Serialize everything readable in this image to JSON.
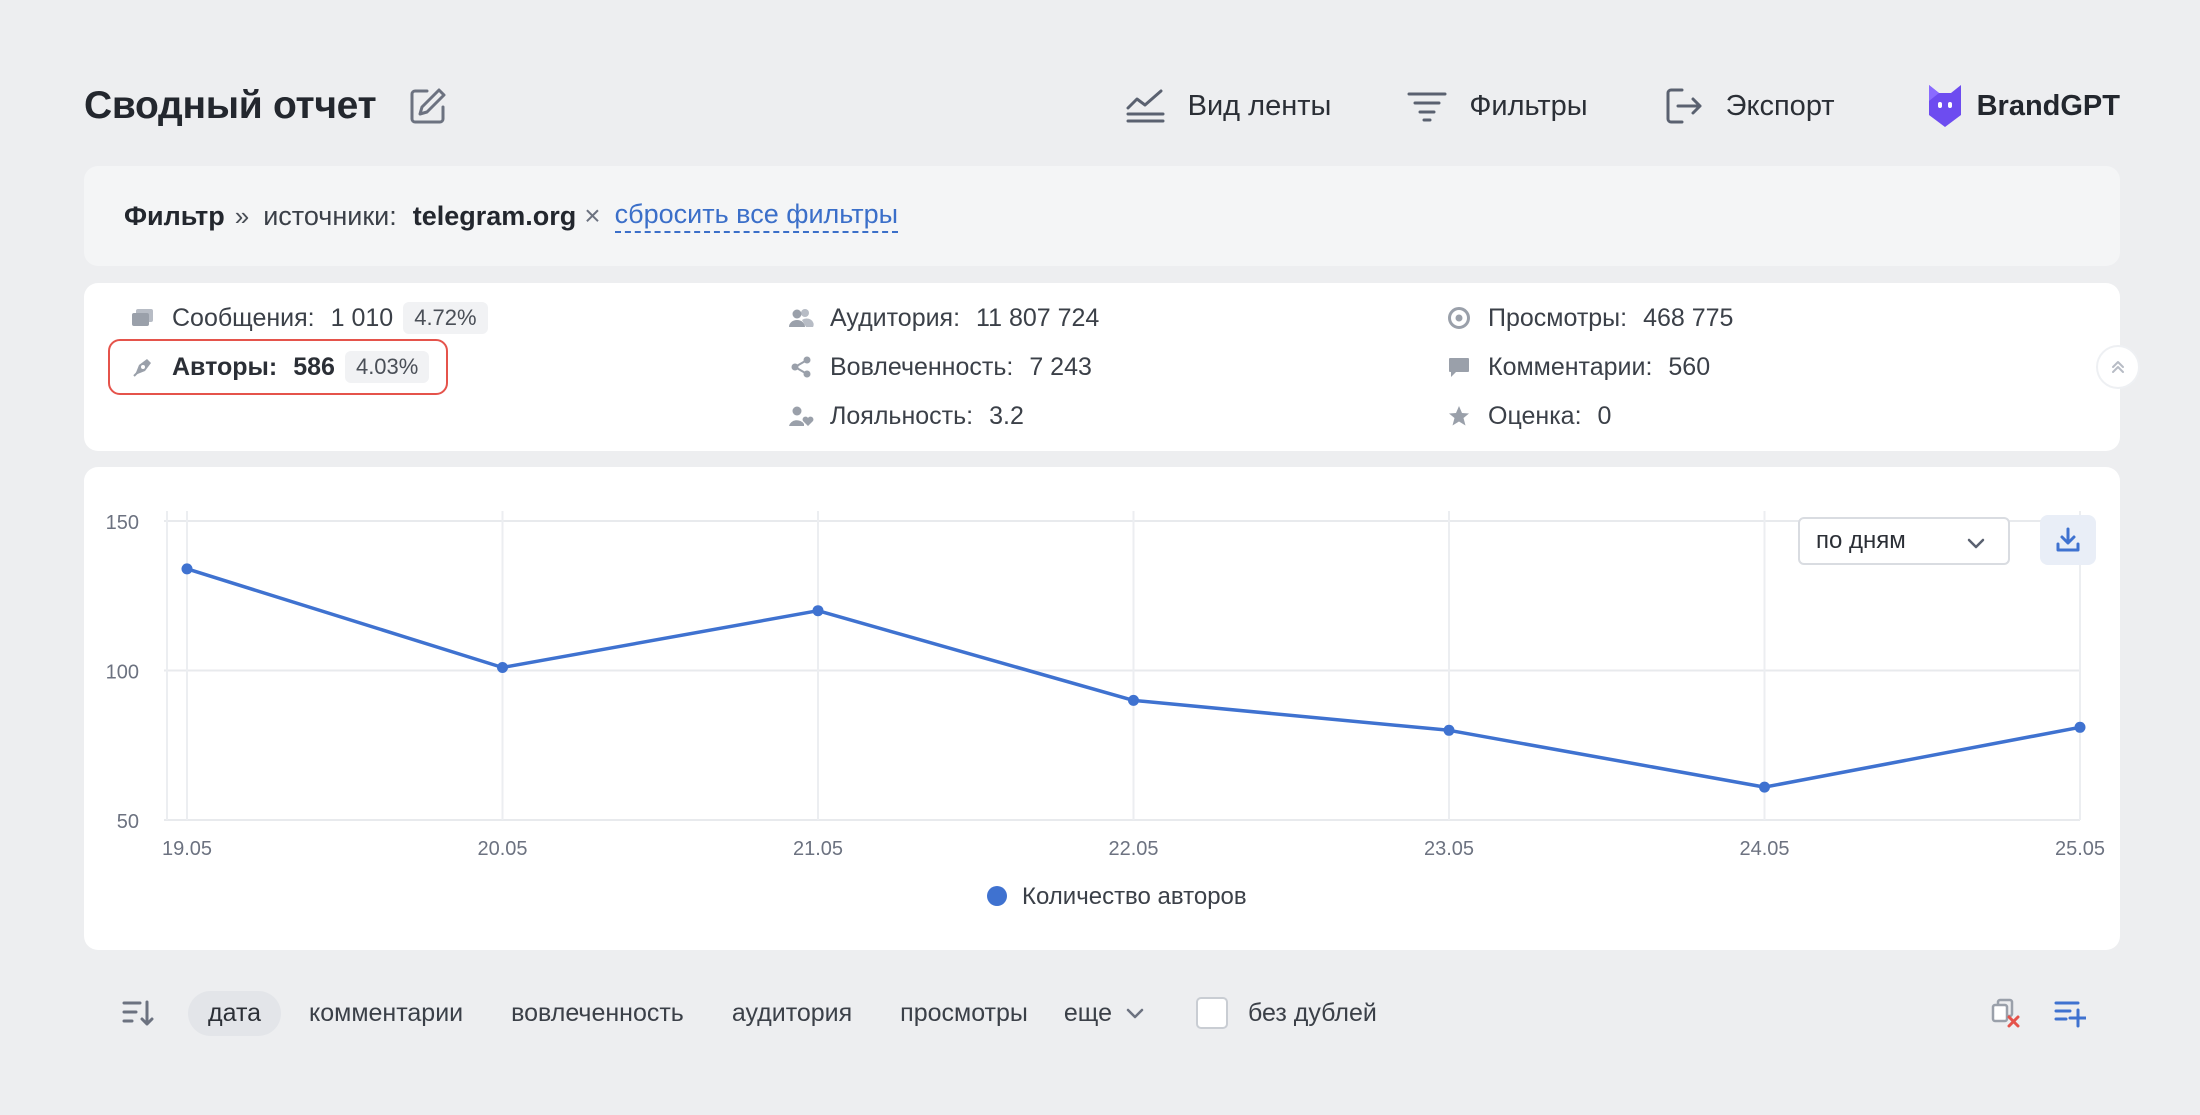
{
  "header": {
    "title": "Сводный отчет",
    "actions": [
      {
        "label": "Вид ленты",
        "icon": "feed-view-icon"
      },
      {
        "label": "Фильтры",
        "icon": "filter-icon"
      },
      {
        "label": "Экспорт",
        "icon": "export-icon"
      }
    ],
    "brand": {
      "label": "BrandGPT",
      "icon": "brandgpt-logo-icon"
    }
  },
  "filter_bar": {
    "title": "Фильтр",
    "separator": "»",
    "key": "источники:",
    "value": "telegram.org",
    "remove": "×",
    "reset": "сбросить все фильтры"
  },
  "stats": {
    "messages": {
      "label": "Сообщения:",
      "value": "1 010",
      "pct": "4.72%"
    },
    "authors": {
      "label": "Авторы:",
      "value": "586",
      "pct": "4.03%"
    },
    "audience": {
      "label": "Аудитория:",
      "value": "11 807 724"
    },
    "engagement": {
      "label": "Вовлеченность:",
      "value": "7 243"
    },
    "loyalty": {
      "label": "Лояльность:",
      "value": "3.2"
    },
    "views": {
      "label": "Просмотры:",
      "value": "468 775"
    },
    "comments": {
      "label": "Комментарии:",
      "value": "560"
    },
    "rating": {
      "label": "Оценка:",
      "value": "0"
    }
  },
  "chart_controls": {
    "period": "по дням"
  },
  "chart_data": {
    "type": "line",
    "x": [
      "19.05",
      "20.05",
      "21.05",
      "22.05",
      "23.05",
      "24.05",
      "25.05"
    ],
    "series": [
      {
        "name": "Количество авторов",
        "values": [
          134,
          101,
          120,
          90,
          80,
          61,
          81
        ],
        "color": "#3f72d0"
      }
    ],
    "y_ticks": [
      50,
      100,
      150
    ],
    "ylim": [
      50,
      150
    ],
    "grid": true,
    "legend": "bottom-center"
  },
  "sort_bar": {
    "items": [
      "дата",
      "комментарии",
      "вовлеченность",
      "аудитория",
      "просмотры"
    ],
    "active": "дата",
    "more": "еще",
    "dedupe": "без дублей"
  },
  "colors": {
    "accent": "#3f72d0",
    "highlight": "#e5534b",
    "brand": "#6d4cf0"
  }
}
